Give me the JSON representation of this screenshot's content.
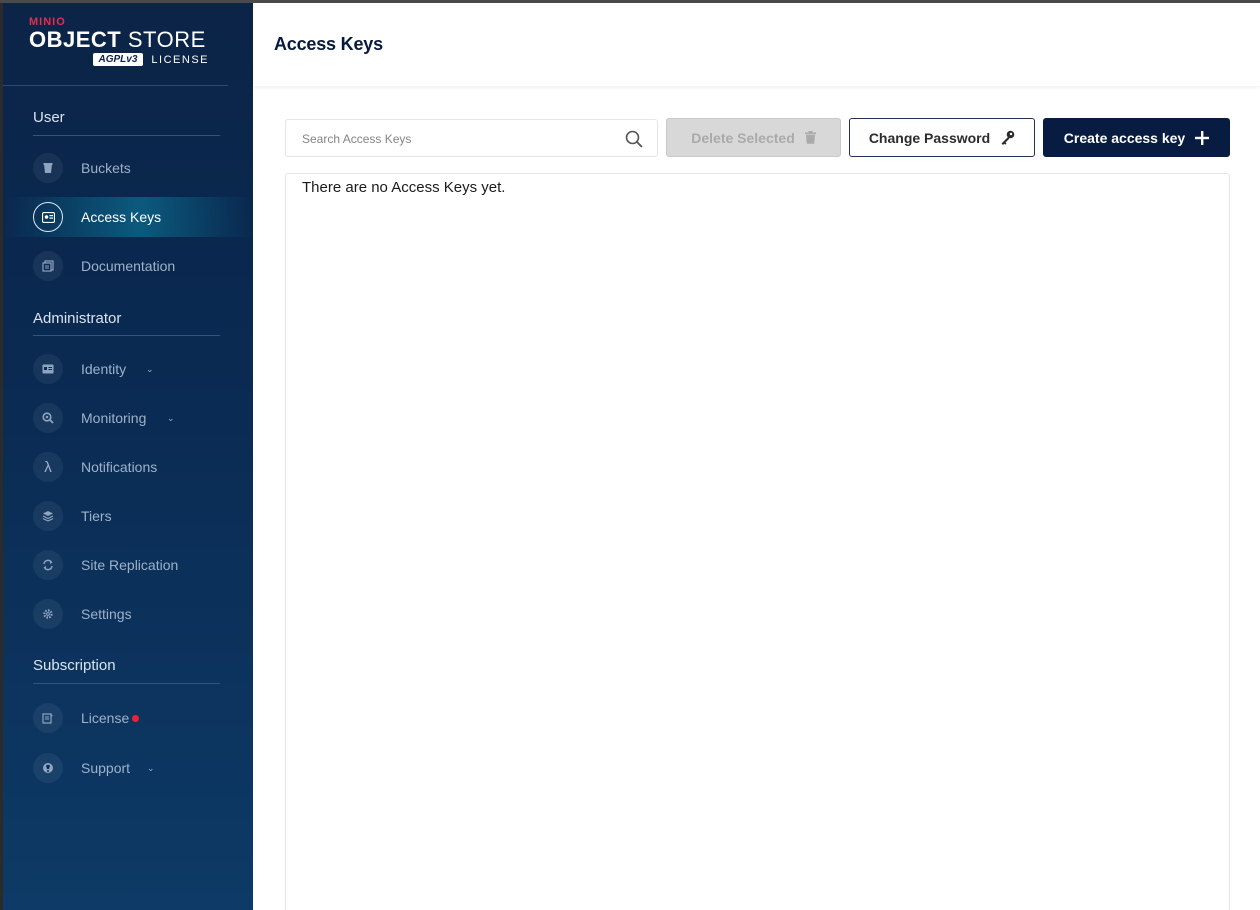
{
  "brand": {
    "company": "MINIO",
    "product_bold": "OBJECT",
    "product_rest": " STORE",
    "agpl": "AGPLv3",
    "license": "LICENSE"
  },
  "sidebar": {
    "sections": [
      {
        "title": "User"
      },
      {
        "title": "Administrator"
      },
      {
        "title": "Subscription"
      }
    ],
    "items": [
      {
        "label": "Buckets",
        "icon": "bucket-icon"
      },
      {
        "label": "Access Keys",
        "icon": "access-key-icon",
        "active": true
      },
      {
        "label": "Documentation",
        "icon": "document-icon"
      },
      {
        "label": "Identity",
        "icon": "identity-icon",
        "expandable": true
      },
      {
        "label": "Monitoring",
        "icon": "monitoring-icon",
        "expandable": true
      },
      {
        "label": "Notifications",
        "icon": "lambda-icon"
      },
      {
        "label": "Tiers",
        "icon": "layers-icon"
      },
      {
        "label": "Site Replication",
        "icon": "replication-icon"
      },
      {
        "label": "Settings",
        "icon": "gear-icon"
      },
      {
        "label": "License",
        "icon": "license-icon",
        "alert": true
      },
      {
        "label": "Support",
        "icon": "support-icon",
        "expandable": true
      }
    ]
  },
  "header": {
    "title": "Access Keys"
  },
  "toolbar": {
    "search_placeholder": "Search Access Keys",
    "delete_label": "Delete Selected",
    "change_password_label": "Change Password",
    "create_label": "Create access key"
  },
  "table": {
    "empty_message": "There are no Access Keys yet."
  },
  "colors": {
    "sidebar_bg": "#0b2447",
    "primary": "#081c42",
    "alert": "#f0203a",
    "disabled": "#d8d8d8"
  }
}
